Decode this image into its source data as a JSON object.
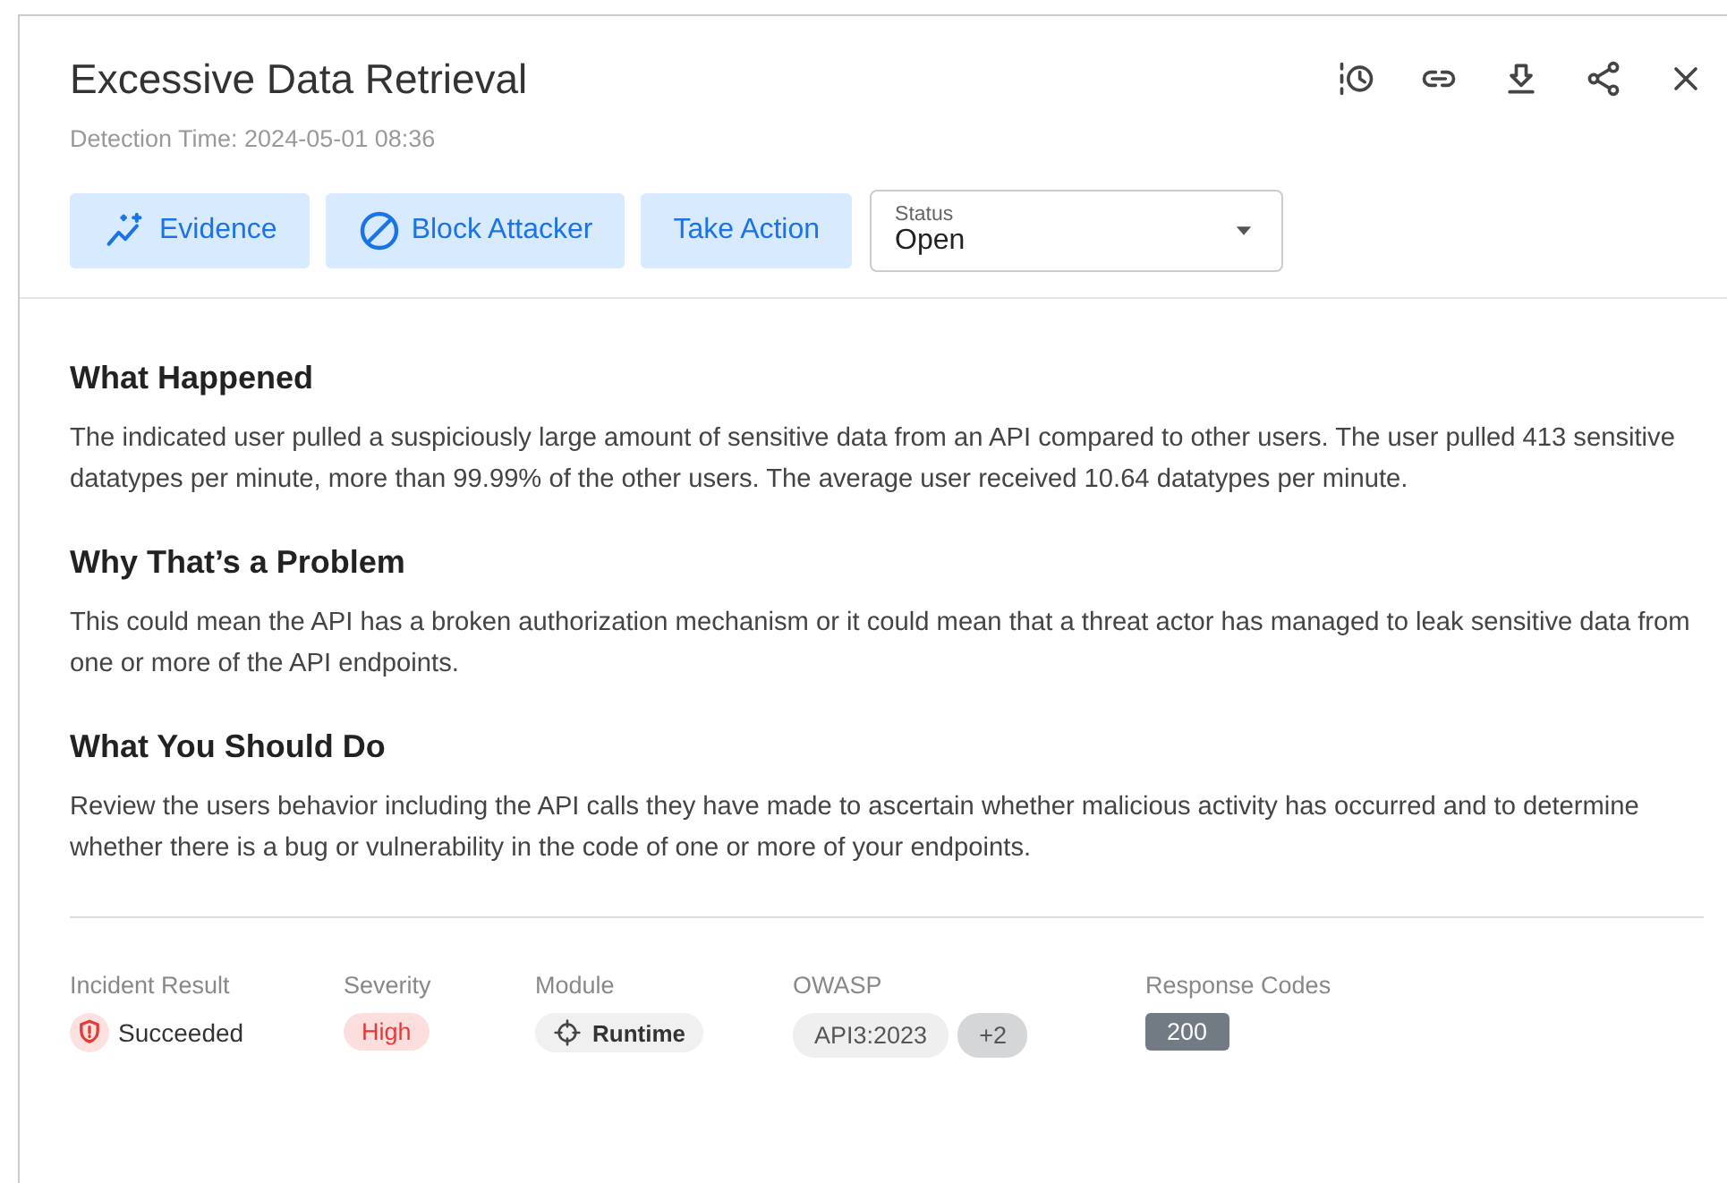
{
  "title": "Excessive Data Retrieval",
  "detection_time": "Detection Time: 2024-05-01 08:36",
  "actions": [
    {
      "label": "Evidence",
      "kind": "sparkle"
    },
    {
      "label": "Block Attacker",
      "kind": "block"
    },
    {
      "label": "Take Action",
      "kind": "plain"
    }
  ],
  "status": {
    "label": "Status",
    "value": "Open"
  },
  "sections": [
    {
      "heading": "What Happened",
      "body": "The indicated user pulled a suspiciously large amount of sensitive data from an API compared to other users. The user pulled 413 sensitive datatypes per minute, more than 99.99% of the other users. The average user received 10.64 datatypes per minute."
    },
    {
      "heading": "Why That’s a Problem",
      "body": "This could mean the API has a broken authorization mechanism or it could mean that a threat actor has managed to leak sensitive data from one or more of the API endpoints."
    },
    {
      "heading": "What You Should Do",
      "body": "Review the users behavior including the API calls they have made to ascertain whether malicious activity has occurred and to determine whether there is a bug or vulnerability in the code of one or more of your endpoints."
    }
  ],
  "details": [
    {
      "label": "Incident Result",
      "kind": "result",
      "values": [
        "Succeeded"
      ]
    },
    {
      "label": "Severity",
      "kind": "severity",
      "values": [
        "High"
      ]
    },
    {
      "label": "Module",
      "kind": "module",
      "values": [
        "Runtime"
      ]
    },
    {
      "label": "OWASP",
      "kind": "chips",
      "values": [
        "API3:2023",
        "+2"
      ]
    },
    {
      "label": "Response Codes",
      "kind": "code",
      "values": [
        "200"
      ]
    }
  ]
}
